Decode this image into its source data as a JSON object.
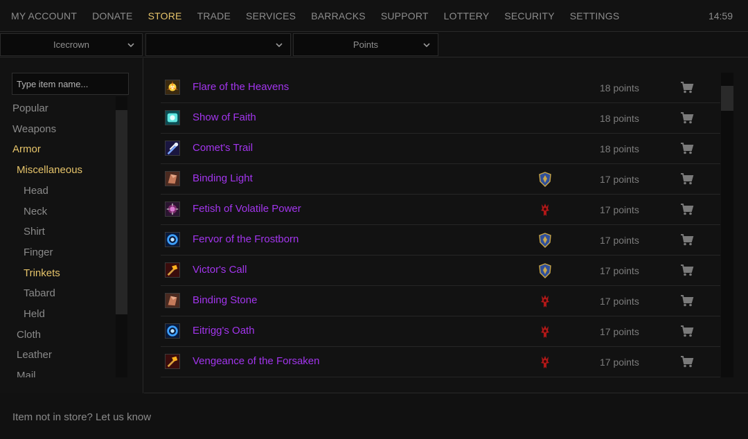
{
  "nav": {
    "items": [
      {
        "label": "MY ACCOUNT",
        "active": false
      },
      {
        "label": "DONATE",
        "active": false
      },
      {
        "label": "STORE",
        "active": true
      },
      {
        "label": "TRADE",
        "active": false
      },
      {
        "label": "SERVICES",
        "active": false
      },
      {
        "label": "BARRACKS",
        "active": false
      },
      {
        "label": "SUPPORT",
        "active": false
      },
      {
        "label": "LOTTERY",
        "active": false
      },
      {
        "label": "SECURITY",
        "active": false
      },
      {
        "label": "SETTINGS",
        "active": false
      }
    ],
    "clock": "14:59"
  },
  "filters": {
    "realm": "Icecrown",
    "character": "",
    "currency": "Points"
  },
  "sidebar": {
    "search_placeholder": "Type item name...",
    "categories": [
      {
        "label": "Popular",
        "level": 0,
        "selected": false
      },
      {
        "label": "Weapons",
        "level": 0,
        "selected": false
      },
      {
        "label": "Armor",
        "level": 0,
        "selected": true
      },
      {
        "label": "Miscellaneous",
        "level": 1,
        "selected": true
      },
      {
        "label": "Head",
        "level": 2,
        "selected": false
      },
      {
        "label": "Neck",
        "level": 2,
        "selected": false
      },
      {
        "label": "Shirt",
        "level": 2,
        "selected": false
      },
      {
        "label": "Finger",
        "level": 2,
        "selected": false
      },
      {
        "label": "Trinkets",
        "level": 2,
        "selected": true
      },
      {
        "label": "Tabard",
        "level": 2,
        "selected": false
      },
      {
        "label": "Held",
        "level": 2,
        "selected": false
      },
      {
        "label": "Cloth",
        "level": 1,
        "selected": false
      },
      {
        "label": "Leather",
        "level": 1,
        "selected": false
      },
      {
        "label": "Mail",
        "level": 1,
        "selected": false
      }
    ]
  },
  "items": [
    {
      "name": "Flare of the Heavens",
      "icon": "flare-icon",
      "faction": "",
      "price": "18 points"
    },
    {
      "name": "Show of Faith",
      "icon": "faith-icon",
      "faction": "",
      "price": "18 points"
    },
    {
      "name": "Comet's Trail",
      "icon": "comet-icon",
      "faction": "",
      "price": "18 points"
    },
    {
      "name": "Binding Light",
      "icon": "binding-icon",
      "faction": "alliance",
      "price": "17 points"
    },
    {
      "name": "Fetish of Volatile Power",
      "icon": "fetish-icon",
      "faction": "horde",
      "price": "17 points"
    },
    {
      "name": "Fervor of the Frostborn",
      "icon": "frost-icon",
      "faction": "alliance",
      "price": "17 points"
    },
    {
      "name": "Victor's Call",
      "icon": "hammer-icon",
      "faction": "alliance",
      "price": "17 points"
    },
    {
      "name": "Binding Stone",
      "icon": "binding-icon",
      "faction": "horde",
      "price": "17 points"
    },
    {
      "name": "Eitrigg's Oath",
      "icon": "frost-icon",
      "faction": "horde",
      "price": "17 points"
    },
    {
      "name": "Vengeance of the Forsaken",
      "icon": "hammer-icon",
      "faction": "horde",
      "price": "17 points"
    }
  ],
  "footer": {
    "link": "Item not in store? Let us know"
  },
  "colors": {
    "accent": "#e6c46a",
    "epic_item": "#a335ee",
    "alliance": "#3a5fa8",
    "horde": "#b01818"
  }
}
